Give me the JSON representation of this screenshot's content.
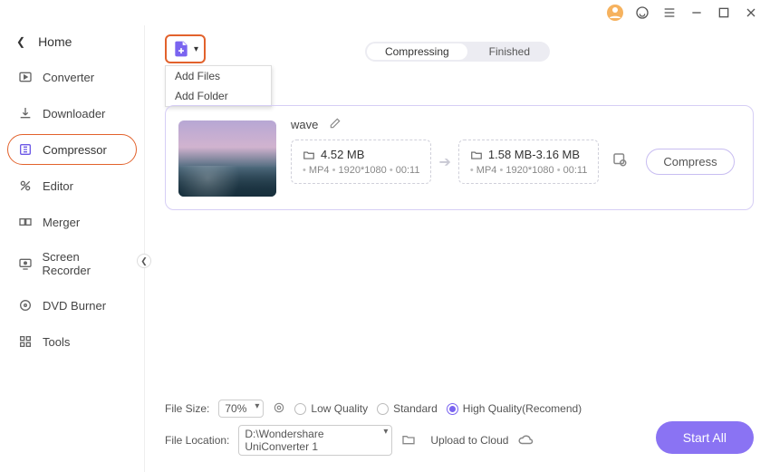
{
  "home_label": "Home",
  "nav": [
    {
      "label": "Converter"
    },
    {
      "label": "Downloader"
    },
    {
      "label": "Compressor"
    },
    {
      "label": "Editor"
    },
    {
      "label": "Merger"
    },
    {
      "label": "Screen Recorder"
    },
    {
      "label": "DVD Burner"
    },
    {
      "label": "Tools"
    }
  ],
  "add_menu": {
    "files": "Add Files",
    "folder": "Add Folder"
  },
  "tabs": {
    "compressing": "Compressing",
    "finished": "Finished"
  },
  "item": {
    "name": "wave",
    "src": {
      "size": "4.52 MB",
      "fmt": "MP4",
      "res": "1920*1080",
      "dur": "00:11"
    },
    "dst": {
      "size": "1.58 MB-3.16 MB",
      "fmt": "MP4",
      "res": "1920*1080",
      "dur": "00:11"
    },
    "compress_label": "Compress"
  },
  "footer": {
    "filesize_label": "File Size:",
    "filesize_value": "70%",
    "quality": {
      "low": "Low Quality",
      "standard": "Standard",
      "high": "High Quality(Recomend)"
    },
    "location_label": "File Location:",
    "location_value": "D:\\Wondershare UniConverter 1",
    "upload_label": "Upload to Cloud",
    "start_all": "Start All"
  }
}
